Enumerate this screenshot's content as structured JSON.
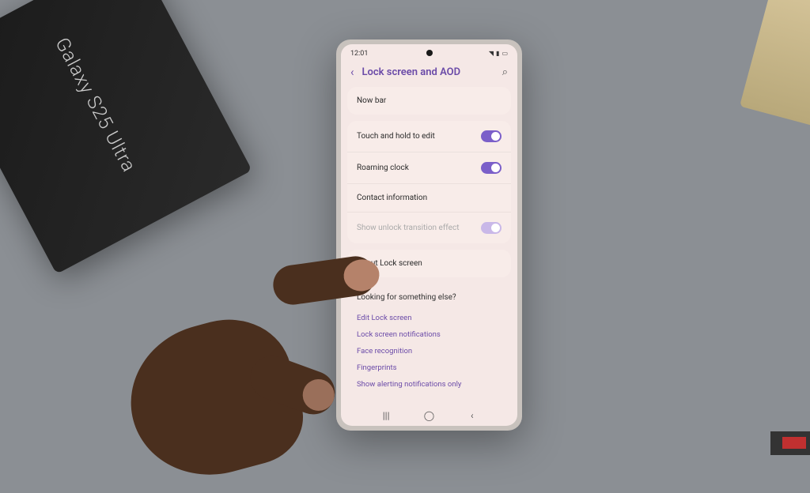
{
  "product_box": {
    "label": "Galaxy S25 Ultra"
  },
  "status": {
    "time": "12:01"
  },
  "header": {
    "title": "Lock screen and AOD"
  },
  "group1": {
    "row0": {
      "label": "Now bar"
    }
  },
  "group2": {
    "row0": {
      "label": "Touch and hold to edit",
      "toggle": true
    },
    "row1": {
      "label": "Roaming clock",
      "toggle": true
    },
    "row2": {
      "label": "Contact information"
    },
    "row3": {
      "label": "Show unlock transition effect",
      "toggle": true
    }
  },
  "group3": {
    "row0": {
      "label": "About Lock screen"
    }
  },
  "footer": {
    "heading": "Looking for something else?",
    "links": {
      "l0": "Edit Lock screen",
      "l1": "Lock screen notifications",
      "l2": "Face recognition",
      "l3": "Fingerprints",
      "l4": "Show alerting notifications only"
    }
  }
}
